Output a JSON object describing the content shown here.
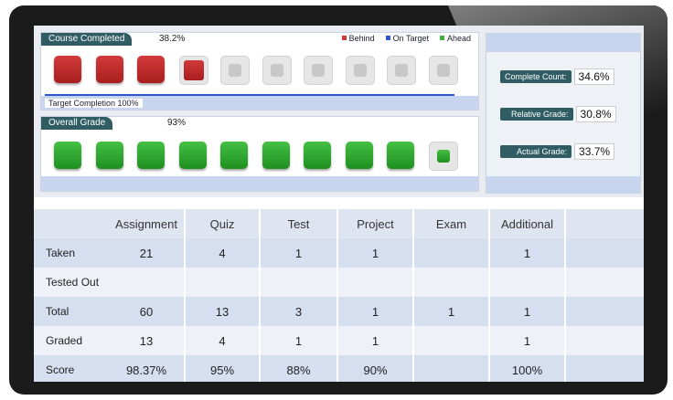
{
  "course_completed": {
    "label": "Course Completed",
    "percent": "38.2%",
    "tiles": [
      "red",
      "red",
      "red",
      "red-small",
      "grey",
      "grey",
      "grey",
      "grey",
      "grey",
      "grey"
    ]
  },
  "legend": {
    "behind": "Behind",
    "on_target": "On Target",
    "ahead": "Ahead",
    "behind_color": "#d23a3a",
    "on_target_color": "#2f55d4",
    "ahead_color": "#3cb33c"
  },
  "target_completion": "Target Completion  100%",
  "overall_grade": {
    "label": "Overall Grade",
    "percent": "93%",
    "tiles": [
      "green",
      "green",
      "green",
      "green",
      "green",
      "green",
      "green",
      "green",
      "green",
      "green-small"
    ]
  },
  "stats": [
    {
      "label": "Complete Count:",
      "value": "34.6%"
    },
    {
      "label": "Relative Grade:",
      "value": "30.8%"
    },
    {
      "label": "Actual Grade:",
      "value": "33.7%"
    }
  ],
  "table": {
    "headers": [
      "",
      "Assignment",
      "Quiz",
      "Test",
      "Project",
      "Exam",
      "Additional",
      ""
    ],
    "rows": [
      {
        "label": "Taken",
        "cells": [
          "21",
          "4",
          "1",
          "1",
          "",
          "1",
          ""
        ]
      },
      {
        "label": "Tested Out",
        "cells": [
          "",
          "",
          "",
          "",
          "",
          "",
          ""
        ]
      },
      {
        "label": "Total",
        "cells": [
          "60",
          "13",
          "3",
          "1",
          "1",
          "1",
          ""
        ]
      },
      {
        "label": "Graded",
        "cells": [
          "13",
          "4",
          "1",
          "1",
          "",
          "1",
          ""
        ]
      },
      {
        "label": "Score",
        "cells": [
          "98.37%",
          "95%",
          "88%",
          "90%",
          "",
          "100%",
          ""
        ]
      }
    ]
  }
}
